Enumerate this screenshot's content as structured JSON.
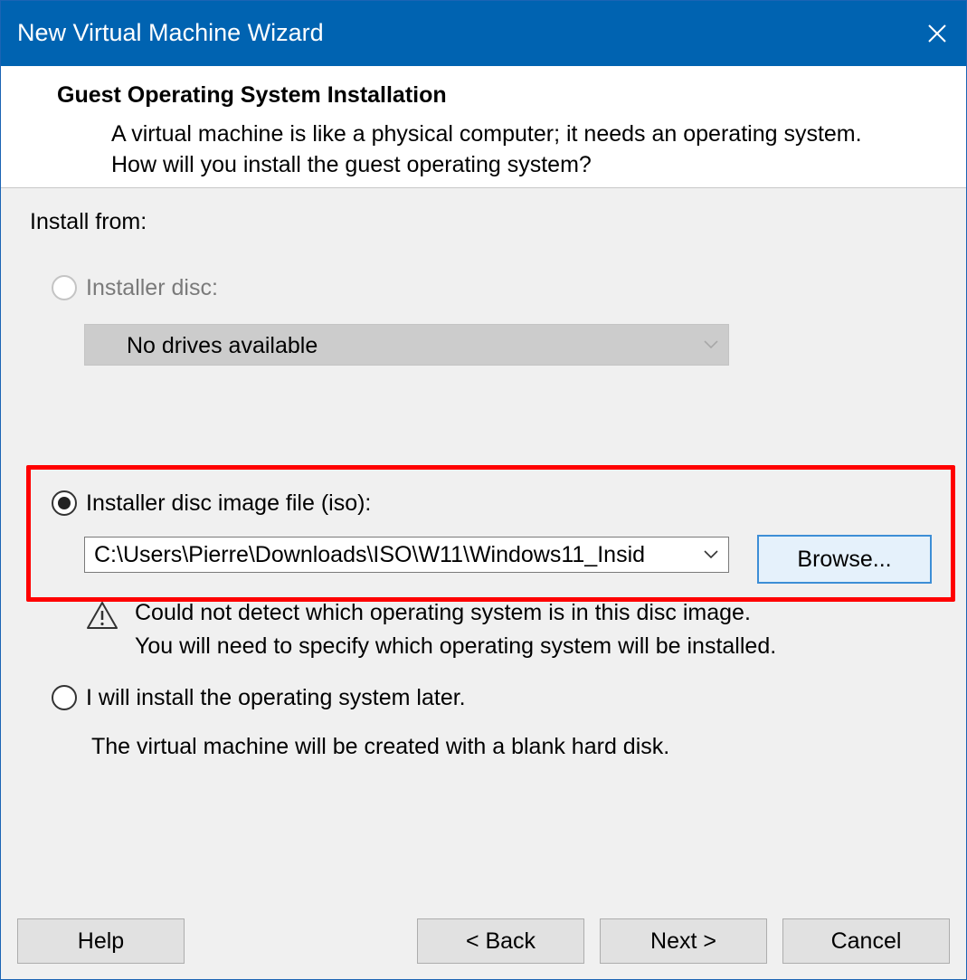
{
  "window": {
    "title": "New Virtual Machine Wizard"
  },
  "header": {
    "title": "Guest Operating System Installation",
    "description": "A virtual machine is like a physical computer; it needs an operating system. How will you install the guest operating system?"
  },
  "install_from_label": "Install from:",
  "options": {
    "installer_disc": {
      "label": "Installer disc:",
      "selected": false,
      "enabled": false,
      "dropdown_value": "No drives available"
    },
    "iso_file": {
      "label": "Installer disc image file (iso):",
      "selected": true,
      "path_value": "C:\\Users\\Pierre\\Downloads\\ISO\\W11\\Windows11_Insid",
      "browse_label": "Browse...",
      "warning_line1": "Could not detect which operating system is in this disc image.",
      "warning_line2": "You will need to specify which operating system will be installed."
    },
    "install_later": {
      "label": "I will install the operating system later.",
      "selected": false,
      "description": "The virtual machine will be created with a blank hard disk."
    }
  },
  "buttons": {
    "help": "Help",
    "back": "< Back",
    "next": "Next >",
    "cancel": "Cancel"
  },
  "colors": {
    "titlebar": "#0063b1",
    "highlight": "#ff0000",
    "button_focus_border": "#3d8ed6"
  }
}
